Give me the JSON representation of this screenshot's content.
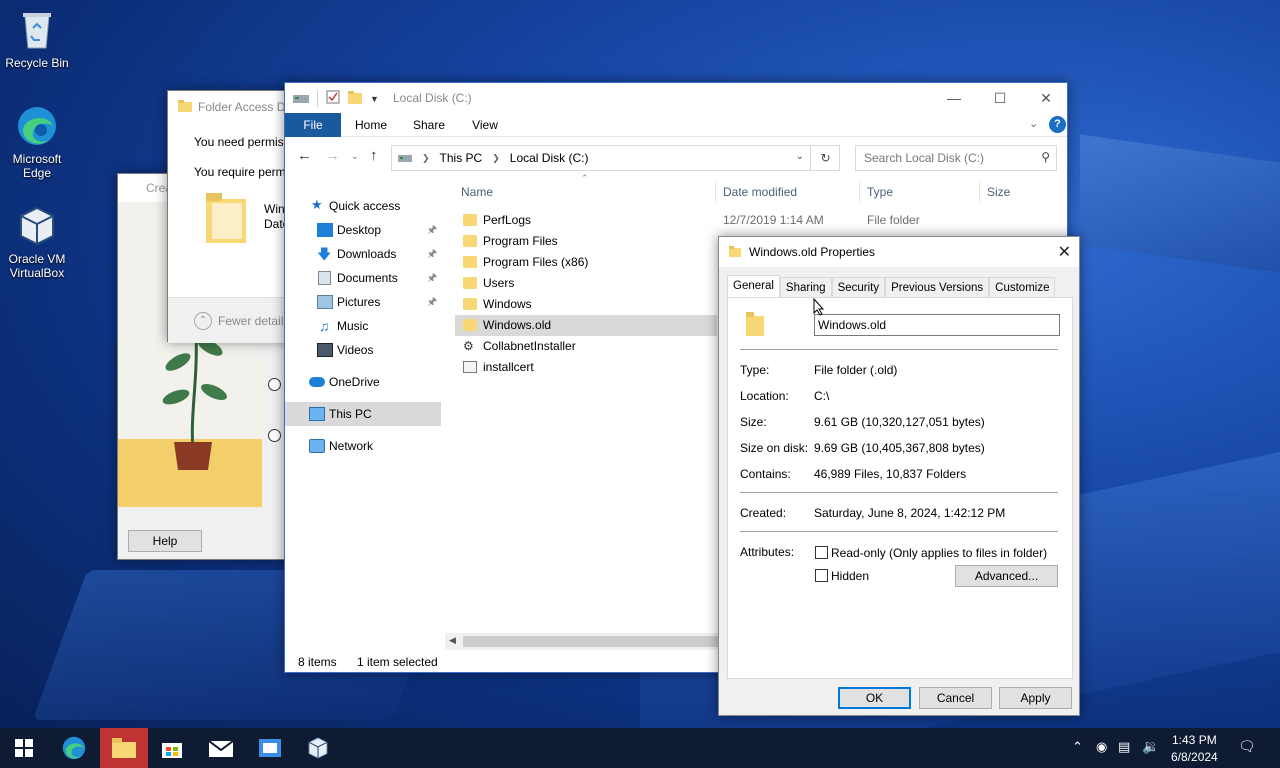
{
  "desktop": {
    "icons": [
      {
        "label": "Recycle Bin"
      },
      {
        "label": "Microsoft Edge"
      },
      {
        "label": "Oracle VM VirtualBox"
      }
    ]
  },
  "vbox_dialog": {
    "title": "Crea",
    "help_label": "Help"
  },
  "folder_access": {
    "title": "Folder Access De",
    "line1": "You need permis",
    "line2": "You require perm",
    "file_name": "Win",
    "file_date": "Date",
    "fewer_details": "Fewer details"
  },
  "explorer": {
    "title": "Local Disk (C:)",
    "ribbon_tabs": [
      "File",
      "Home",
      "Share",
      "View"
    ],
    "breadcrumb": [
      "This PC",
      "Local Disk (C:)"
    ],
    "search_placeholder": "Search Local Disk (C:)",
    "nav": {
      "quick_access": "Quick access",
      "desktop": "Desktop",
      "downloads": "Downloads",
      "documents": "Documents",
      "pictures": "Pictures",
      "music": "Music",
      "videos": "Videos",
      "onedrive": "OneDrive",
      "this_pc": "This PC",
      "network": "Network"
    },
    "columns": {
      "name": "Name",
      "date": "Date modified",
      "type": "Type",
      "size": "Size"
    },
    "files": [
      {
        "name": "PerfLogs",
        "date": "12/7/2019 1:14 AM",
        "type": "File folder",
        "icon": "folder-icon"
      },
      {
        "name": "Program Files",
        "date": "",
        "type": "",
        "icon": "folder-icon"
      },
      {
        "name": "Program Files (x86)",
        "date": "",
        "type": "",
        "icon": "folder-icon"
      },
      {
        "name": "Users",
        "date": "",
        "type": "",
        "icon": "folder-icon"
      },
      {
        "name": "Windows",
        "date": "",
        "type": "",
        "icon": "folder-icon"
      },
      {
        "name": "Windows.old",
        "date": "",
        "type": "",
        "icon": "folder-icon",
        "selected": true
      },
      {
        "name": "CollabnetInstaller",
        "date": "",
        "type": "",
        "icon": "gear-file-icon"
      },
      {
        "name": "installcert",
        "date": "",
        "type": "",
        "icon": "file-icon"
      }
    ],
    "status": {
      "items": "8 items",
      "selected": "1 item selected"
    }
  },
  "properties": {
    "title": "Windows.old Properties",
    "tabs": [
      "General",
      "Sharing",
      "Security",
      "Previous Versions",
      "Customize"
    ],
    "name_value": "Windows.old",
    "type_label": "Type:",
    "type_value": "File folder (.old)",
    "location_label": "Location:",
    "location_value": "C:\\",
    "size_label": "Size:",
    "size_value": "9.61 GB (10,320,127,051 bytes)",
    "size_on_disk_label": "Size on disk:",
    "size_on_disk_value": "9.69 GB (10,405,367,808 bytes)",
    "contains_label": "Contains:",
    "contains_value": "46,989 Files, 10,837 Folders",
    "created_label": "Created:",
    "created_value": "Saturday, June 8, 2024, 1:42:12 PM",
    "attributes_label": "Attributes:",
    "readonly_label": "Read-only (Only applies to files in folder)",
    "hidden_label": "Hidden",
    "advanced_label": "Advanced...",
    "ok_label": "OK",
    "cancel_label": "Cancel",
    "apply_label": "Apply"
  },
  "taskbar": {
    "time": "1:43 PM",
    "date": "6/8/2024"
  },
  "colors": {
    "accent": "#0078d7",
    "ribbon_file": "#19599e",
    "folder": "#f8d775",
    "taskbar": "#0e1b33"
  }
}
